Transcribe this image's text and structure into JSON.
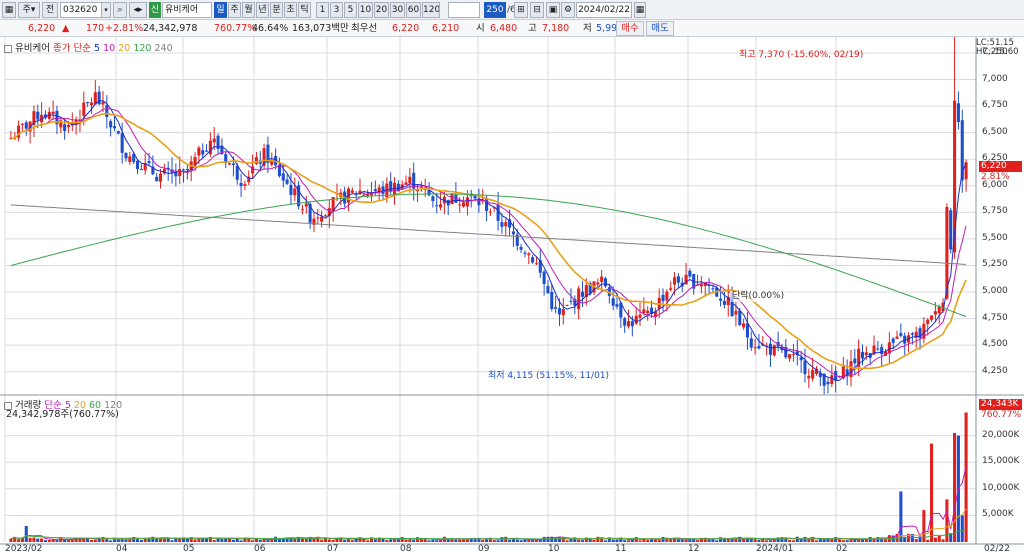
{
  "toolbar": {
    "mode_a": "주",
    "mode_b": "전",
    "code": "032620",
    "badge": "신",
    "stock_name": "유비케어",
    "periods": [
      "일",
      "주",
      "월",
      "년",
      "분",
      "초",
      "틱"
    ],
    "active_period": "일",
    "minute_options": [
      "1",
      "3",
      "5",
      "10",
      "20",
      "30",
      "60",
      "120"
    ],
    "count_value": "250",
    "count_total": "/600",
    "date": "2024/02/22"
  },
  "quote": {
    "price": "6,220",
    "arrow": "▲",
    "change": "170",
    "change_pct": "+2.81%",
    "volume": "24,342,978",
    "volume_ratio": "760.77%",
    "turnover": "46.64%",
    "amount": "163,073백만",
    "priority_label": "최우선",
    "ask": "6,220",
    "bid": "6,210",
    "open_label": "시",
    "open": "6,480",
    "high_label": "고",
    "high": "7,180",
    "low_label": "저",
    "low": "5,990",
    "buy_label": "매수",
    "sell_label": "매도"
  },
  "price_panel": {
    "legend_name": "유비케어",
    "legend_ma_label": "종가 단순",
    "ma_periods": [
      "5",
      "10",
      "20",
      "120",
      "240"
    ],
    "ma_colors": [
      "#1b2ccf",
      "#c21fb5",
      "#e8a117",
      "#3aa64a",
      "#808080"
    ],
    "y_ticks": [
      "7,250",
      "7,000",
      "6,750",
      "6,500",
      "6,250",
      "6,000",
      "5,750",
      "5,500",
      "5,250",
      "5,000",
      "4,750",
      "4,500",
      "4,250"
    ],
    "lc": "LC:51.15",
    "hc": "HC:-15.60",
    "price_tag": "6,220",
    "pct_tag": "2.81%",
    "high_note": "최고 7,370 (-15.60%, 02/19)",
    "low_note": "최저 4,115 (51.15%, 11/01)",
    "mid_note": "단락(0.00%)"
  },
  "volume_panel": {
    "legend_name": "거래량",
    "legend_ma_label": "단순",
    "ma_periods": [
      "5",
      "20",
      "60",
      "120"
    ],
    "ma_colors": [
      "#c21fb5",
      "#e8a117",
      "#3aa64a",
      "#808080"
    ],
    "volume_text": "24,342,978주(760.77%)",
    "y_ticks": [
      "20,000K",
      "15,000K",
      "10,000K",
      "5,000K"
    ],
    "vol_tag": "24,343K",
    "vol_pct_tag": "760.77%"
  },
  "x_axis": {
    "labels": [
      "2023/02",
      "04",
      "05",
      "06",
      "07",
      "08",
      "09",
      "10",
      "11",
      "12",
      "2024/01",
      "02"
    ],
    "right_label": "02/22"
  },
  "colors": {
    "up": "#e0201c",
    "down": "#1d4fcc",
    "grid": "#d7dbe3"
  }
}
